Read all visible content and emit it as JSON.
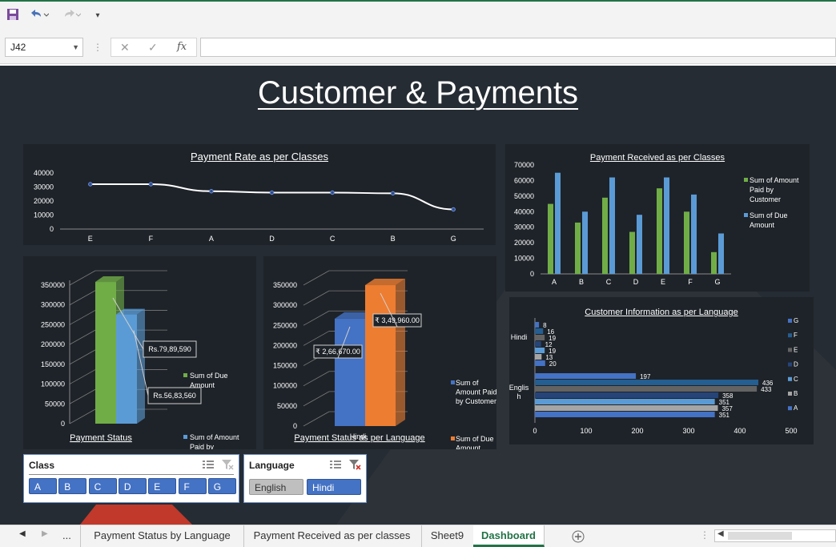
{
  "toolbar": {
    "save_icon": "save-icon",
    "undo_icon": "undo-icon",
    "redo_icon": "redo-icon",
    "customize_icon": "customize-icon"
  },
  "formula_bar": {
    "name_box": "J42",
    "cancel": "✕",
    "enter": "✓",
    "fx": "fx",
    "value": ""
  },
  "dashboard": {
    "title": "Customer & Payments"
  },
  "chart_data": [
    {
      "id": "payment-rate",
      "type": "line",
      "title": "Payment Rate as per Classes",
      "categories": [
        "E",
        "F",
        "A",
        "D",
        "C",
        "B",
        "G"
      ],
      "values": [
        32000,
        32000,
        27000,
        26000,
        26000,
        25500,
        14000
      ],
      "yticks": [
        "40000",
        "30000",
        "20000",
        "10000",
        "0"
      ],
      "ylim": [
        0,
        40000
      ],
      "color": "#ffffff"
    },
    {
      "id": "payment-received-classes",
      "type": "bar",
      "title": "Payment Received as per Classes",
      "categories": [
        "A",
        "B",
        "C",
        "D",
        "E",
        "F",
        "G"
      ],
      "series": [
        {
          "name": "Sum of Amount Paid by Customer",
          "color": "#70ad47",
          "values": [
            45000,
            33000,
            49000,
            27000,
            55000,
            40000,
            14000
          ]
        },
        {
          "name": "Sum of Due Amount",
          "color": "#5b9bd5",
          "values": [
            65000,
            40000,
            62000,
            38000,
            62000,
            51000,
            26000
          ]
        }
      ],
      "yticks": [
        "70000",
        "60000",
        "50000",
        "40000",
        "30000",
        "20000",
        "10000",
        "0"
      ],
      "ylim": [
        0,
        70000
      ],
      "legend": "right"
    },
    {
      "id": "payment-status",
      "type": "bar",
      "title": "Payment Status",
      "series": [
        {
          "name": "Sum of Due Amount",
          "color": "#70ad47",
          "value": 358000,
          "label": "Rs.79,89,590"
        },
        {
          "name": "Sum of Amount Paid by Customer",
          "color": "#5b9bd5",
          "value": 276000,
          "label": "Rs.56,83,560"
        }
      ],
      "yticks": [
        "350000",
        "300000",
        "250000",
        "200000",
        "150000",
        "100000",
        "50000",
        "0"
      ],
      "ylim": [
        0,
        350000
      ],
      "legend": "right"
    },
    {
      "id": "payment-status-language",
      "type": "bar",
      "title": "Payment Status as per Language",
      "categories": [
        "Hindi"
      ],
      "series": [
        {
          "name": "Sum of Amount Paid by Customer",
          "color": "#4472c4",
          "value": 266670,
          "label": "₹ 2,66,670.00"
        },
        {
          "name": "Sum of Due Amount",
          "color": "#ed7d31",
          "value": 349960,
          "label": "₹ 3,49,960.00"
        }
      ],
      "yticks": [
        "350000",
        "300000",
        "250000",
        "200000",
        "150000",
        "100000",
        "50000",
        "0"
      ],
      "ylim": [
        0,
        350000
      ],
      "legend": "right"
    },
    {
      "id": "customer-info-language",
      "type": "bar",
      "title": "Customer Information as per Language",
      "categories": [
        "Hindi",
        "Englis h"
      ],
      "series": [
        {
          "name": "G",
          "color": "#4472c4",
          "values": [
            8,
            197
          ]
        },
        {
          "name": "F",
          "color": "#255e91",
          "values": [
            16,
            436
          ]
        },
        {
          "name": "E",
          "color": "#636363",
          "values": [
            19,
            433
          ]
        },
        {
          "name": "D",
          "color": "#264478",
          "values": [
            12,
            358
          ]
        },
        {
          "name": "C",
          "color": "#5b9bd5",
          "values": [
            19,
            351
          ]
        },
        {
          "name": "B",
          "color": "#a5a5a5",
          "values": [
            13,
            357
          ]
        },
        {
          "name": "A",
          "color": "#4472c4",
          "values": [
            20,
            351
          ]
        }
      ],
      "xticks": [
        "0",
        "100",
        "200",
        "300",
        "400",
        "500"
      ],
      "xlim": [
        0,
        500
      ],
      "legend": "right"
    }
  ],
  "slicers": {
    "class": {
      "title": "Class",
      "items": [
        "A",
        "B",
        "C",
        "D",
        "E",
        "F",
        "G"
      ]
    },
    "language": {
      "title": "Language",
      "items": [
        {
          "label": "English",
          "selected": false
        },
        {
          "label": "Hindi",
          "selected": true
        }
      ]
    }
  },
  "sheet_tabs": {
    "ellipsis": "...",
    "tabs": [
      "Payment Status by Language",
      "Payment Received as per classes",
      "Sheet9",
      "Dashboard"
    ],
    "active": "Dashboard"
  }
}
